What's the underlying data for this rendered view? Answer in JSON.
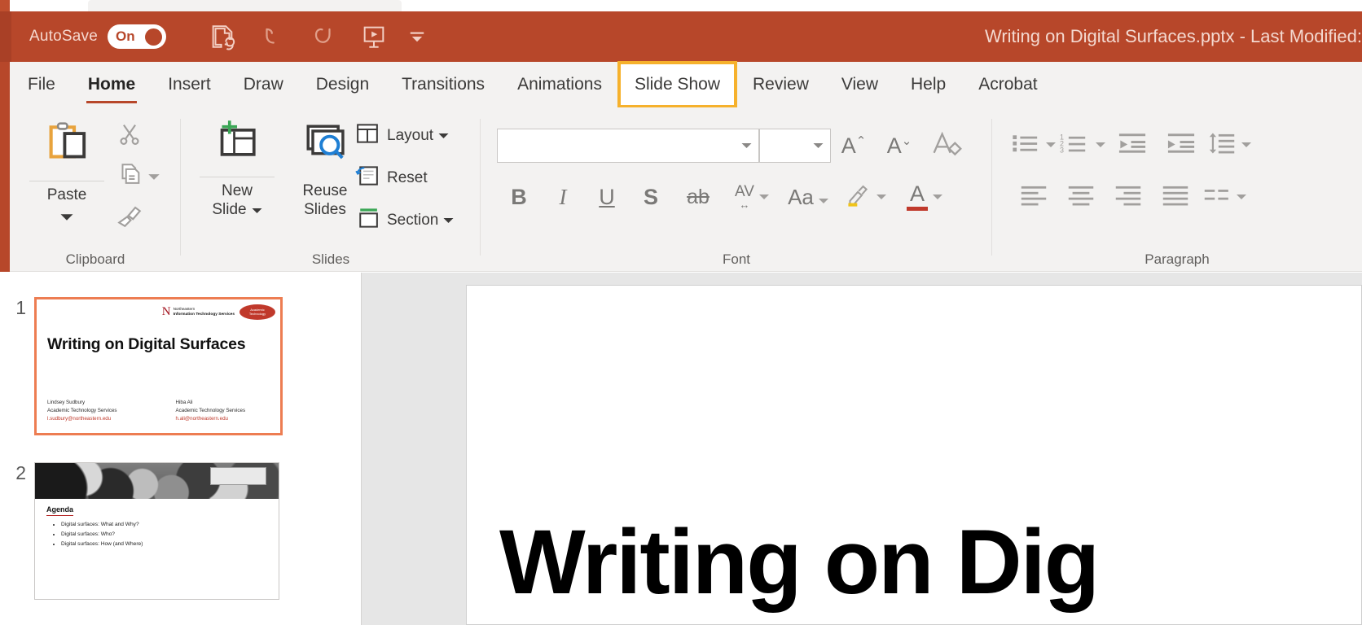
{
  "window": {
    "autosave_label": "AutoSave",
    "autosave_state": "On",
    "document_title": "Writing on Digital Surfaces.pptx  -  Last Modified:",
    "theme_color": "#b7472a",
    "quick_access": [
      {
        "name": "save-icon",
        "tooltip": "Save"
      },
      {
        "name": "undo-icon",
        "tooltip": "Undo"
      },
      {
        "name": "redo-icon",
        "tooltip": "Redo"
      },
      {
        "name": "start-presentation-icon",
        "tooltip": "Start From Beginning"
      },
      {
        "name": "customize-quick-access-toolbar-icon",
        "tooltip": "Customize Quick Access Toolbar"
      }
    ]
  },
  "ribbon": {
    "tabs": [
      {
        "label": "File",
        "state": "normal"
      },
      {
        "label": "Home",
        "state": "active"
      },
      {
        "label": "Insert",
        "state": "normal"
      },
      {
        "label": "Draw",
        "state": "normal"
      },
      {
        "label": "Design",
        "state": "normal"
      },
      {
        "label": "Transitions",
        "state": "normal"
      },
      {
        "label": "Animations",
        "state": "normal"
      },
      {
        "label": "Slide Show",
        "state": "highlighted"
      },
      {
        "label": "Review",
        "state": "normal"
      },
      {
        "label": "View",
        "state": "normal"
      },
      {
        "label": "Help",
        "state": "normal"
      },
      {
        "label": "Acrobat",
        "state": "normal"
      }
    ],
    "highlight_color": "#f6b12c",
    "groups": {
      "clipboard": {
        "label": "Clipboard",
        "paste_label": "Paste",
        "cut_icon": "cut-scissors-icon",
        "copy_icon": "copy-icon",
        "format_painter_icon": "format-painter-icon"
      },
      "slides": {
        "label": "Slides",
        "new_slide_label": "New\nSlide",
        "new_slide_line1": "New",
        "new_slide_line2": "Slide",
        "reuse_slides_line1": "Reuse",
        "reuse_slides_line2": "Slides",
        "layout_label": "Layout",
        "reset_label": "Reset",
        "section_label": "Section"
      },
      "font": {
        "label": "Font",
        "font_name_value": "",
        "font_size_value": "",
        "increase_font_icon": "increase-font-size-icon",
        "decrease_font_icon": "decrease-font-size-icon",
        "clear_formatting_icon": "clear-formatting-icon",
        "bold_label": "B",
        "italic_label": "I",
        "underline_label": "U",
        "shadow_label": "S",
        "strikethrough_label": "ab",
        "character_spacing_label": "AV",
        "change_case_label": "Aa",
        "text_highlight_icon": "text-highlight-color-icon",
        "font_color_label": "A"
      },
      "paragraph": {
        "label": "Paragraph",
        "bullets_icon": "bullets-icon",
        "numbering_icon": "numbering-icon",
        "decrease_indent_icon": "decrease-indent-icon",
        "increase_indent_icon": "increase-indent-icon",
        "line_spacing_icon": "line-spacing-icon",
        "align_left_icon": "align-left-icon",
        "align_center_icon": "align-center-icon",
        "align_right_icon": "align-right-icon",
        "justify_icon": "justify-icon",
        "columns_icon": "columns-icon"
      }
    }
  },
  "slide_pane": {
    "slides": [
      {
        "number": "1",
        "selected": true,
        "title": "Writing on Digital Surfaces",
        "logo_primary": "Northeastern",
        "logo_sub": "Information Technology Services",
        "logo_badge_line1": "Academic",
        "logo_badge_line2": "Technology",
        "presenters": [
          {
            "name": "Lindsey Sudbury",
            "dept": "Academic Technology Services",
            "email": "l.sudbury@northeastern.edu"
          },
          {
            "name": "Hiba Ali",
            "dept": "Academic Technology Services",
            "email": "h.ali@northeastern.edu"
          }
        ]
      },
      {
        "number": "2",
        "selected": false,
        "heading": "Agenda",
        "bullets": [
          "Digital surfaces: What and Why?",
          "Digital surfaces: Who?",
          "Digital surfaces: How (and Where)"
        ]
      }
    ]
  },
  "canvas": {
    "slide_title_visible": "Writing on Dig"
  }
}
